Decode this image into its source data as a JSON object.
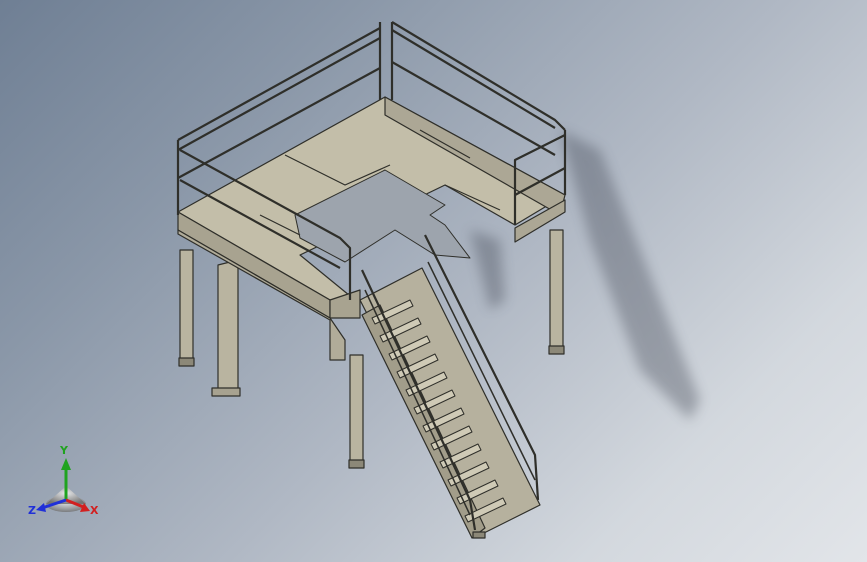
{
  "viewport": {
    "background_top": "#6f7f94",
    "background_bottom": "#e2e5e9",
    "model_color": "#b9b4a0",
    "edge_color": "#2f2f2a"
  },
  "triad": {
    "x_label": "X",
    "y_label": "Y",
    "z_label": "Z",
    "x_color": "#d22020",
    "y_color": "#1fa31f",
    "z_color": "#2030d8"
  }
}
